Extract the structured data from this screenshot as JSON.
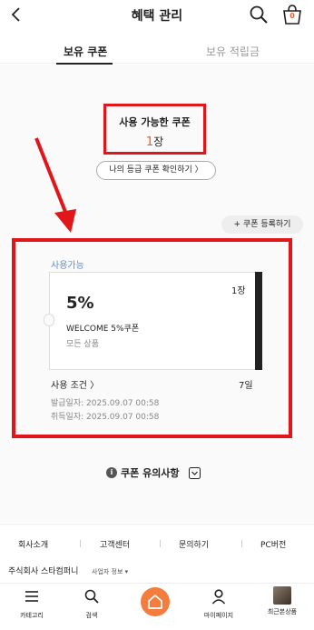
{
  "header": {
    "title": "혜택 관리",
    "cart_count": "0"
  },
  "tabs": {
    "coupon": "보유 쿠폰",
    "points": "보유 적립금"
  },
  "available": {
    "label": "사용 가능한 쿠폰",
    "count": "1",
    "unit": "장"
  },
  "grade_button": "나의 등급 쿠폰 확인하기 〉",
  "register_button": "+ 쿠폰 등록하기",
  "coupon": {
    "status": "사용가능",
    "discount": "5%",
    "quantity": "1장",
    "name": "WELCOME 5%쿠폰",
    "target": "모든 상품",
    "condition_link": "사용 조건 〉",
    "days_left": "7일",
    "issue_date": "발급일자: 2025.09.07 00:58",
    "acquire_date": "취득일자: 2025.09.07 00:58"
  },
  "notice": {
    "icon": "i",
    "label": "쿠폰 유의사항"
  },
  "footer": {
    "links": [
      "회사소개",
      "고객센터",
      "문의하기",
      "PC버전"
    ],
    "company": "주식회사 스타컴퍼니",
    "biz_info": "사업자 정보 ▾"
  },
  "nav": {
    "category": "카테고리",
    "search": "검색",
    "mypage": "마이페이지",
    "recent": "최근본상품"
  },
  "colors": {
    "accent": "#f25a29",
    "annotation_red": "#e0161b",
    "usable_blue": "#5b8fd6"
  }
}
